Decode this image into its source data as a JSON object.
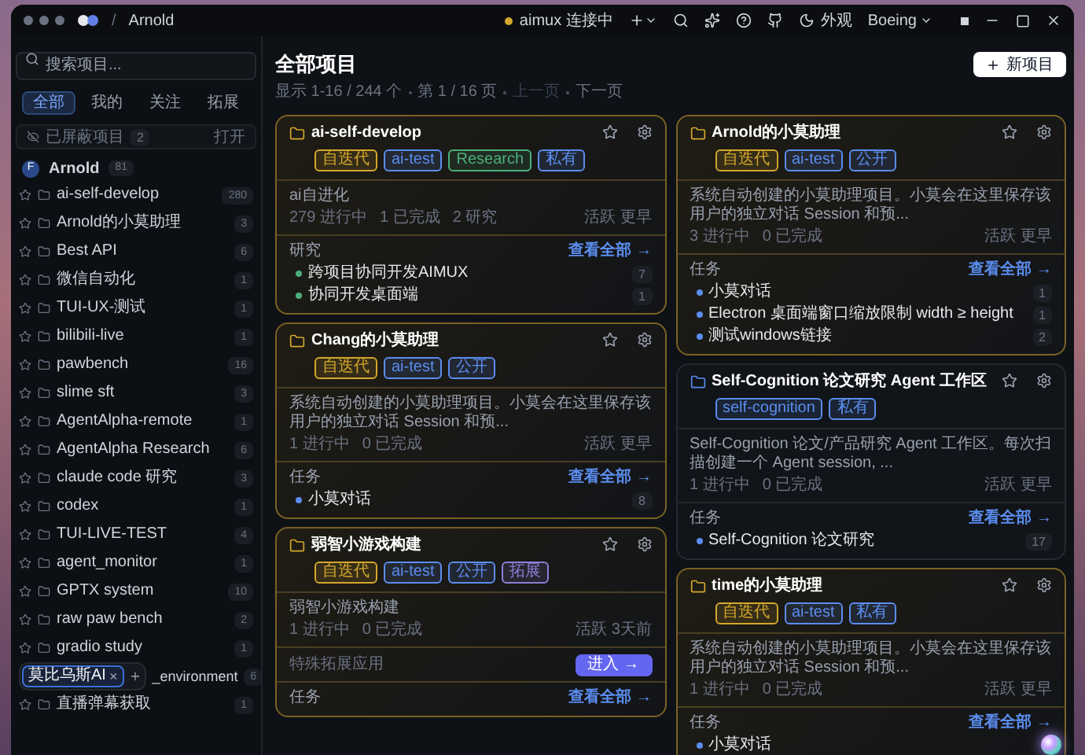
{
  "window": {
    "breadcrumb_separator": "/",
    "title": "Arnold"
  },
  "toolbar": {
    "connection": {
      "label": "aimux 连接中",
      "color": "#d4a72c"
    },
    "appearance": "外观",
    "account": "Boeing"
  },
  "sidebar": {
    "search": {
      "placeholder": "搜索项目..."
    },
    "tabs": [
      {
        "label": "全部",
        "selected": true
      },
      {
        "label": "我的",
        "selected": false
      },
      {
        "label": "关注",
        "selected": false
      },
      {
        "label": "拓展",
        "selected": false
      }
    ],
    "hidden": {
      "label": "已屏蔽项目",
      "count": "2",
      "action": "打开"
    },
    "group": {
      "avatar": "F",
      "name": "Arnold",
      "count": "81"
    },
    "items": [
      {
        "name": "ai-self-develop",
        "count": "280",
        "obscured": false
      },
      {
        "name": "Arnold的小莫助理",
        "count": "3",
        "obscured": false
      },
      {
        "name": "Best API",
        "count": "6",
        "obscured": false
      },
      {
        "name": "微信自动化",
        "count": "1",
        "obscured": false
      },
      {
        "name": "TUI-UX-测试",
        "count": "1",
        "obscured": false
      },
      {
        "name": "bilibili-live",
        "count": "1",
        "obscured": false
      },
      {
        "name": "pawbench",
        "count": "16",
        "obscured": false
      },
      {
        "name": "slime sft",
        "count": "3",
        "obscured": false
      },
      {
        "name": "AgentAlpha-remote",
        "count": "1",
        "obscured": false
      },
      {
        "name": "AgentAlpha Research",
        "count": "6",
        "obscured": false
      },
      {
        "name": "claude code 研究",
        "count": "3",
        "obscured": false
      },
      {
        "name": "codex",
        "count": "1",
        "obscured": false
      },
      {
        "name": "TUI-LIVE-TEST",
        "count": "4",
        "obscured": false
      },
      {
        "name": "agent_monitor",
        "count": "1",
        "obscured": false
      },
      {
        "name": "GPTX system",
        "count": "10",
        "obscured": false
      },
      {
        "name": "raw paw bench",
        "count": "2",
        "obscured": false
      },
      {
        "name": "gradio study",
        "count": "1",
        "obscured": false
      },
      {
        "name": "_environment",
        "count": "6",
        "obscured": true
      },
      {
        "name": "直播弹幕获取",
        "count": "1",
        "obscured": false
      }
    ],
    "floating_tab": {
      "label": "莫比乌斯AI",
      "close": "×"
    }
  },
  "main": {
    "title": "全部项目",
    "new_button": "新项目",
    "pagination": [
      {
        "text": "显示 1-16 / 244 个",
        "disabled": false
      },
      {
        "text": "第 1 / 16 页",
        "disabled": false
      },
      {
        "text": "上一页",
        "disabled": true
      },
      {
        "text": "下一页",
        "disabled": false
      }
    ],
    "project_columns": [
      [
        {
          "name": "ai-self-develop",
          "highlighted": true,
          "tags": [
            {
              "label": "自迭代",
              "color": "#d4a72c"
            },
            {
              "label": "ai-test",
              "color": "#5b8def"
            },
            {
              "label": "Research",
              "color": "#4caf7a"
            },
            {
              "label": "私有",
              "color": "#5b8def"
            }
          ],
          "description": "ai自进化",
          "stats": [
            "279 进行中",
            "1 已完成",
            "2 研究"
          ],
          "activity": "活跃 更早",
          "section": {
            "kind": "research",
            "title": "研究",
            "link": "查看全部 →",
            "items": [
              {
                "name": "跨项目协同开发AIMUX",
                "count": "7"
              },
              {
                "name": "协同开发桌面端",
                "count": "1"
              }
            ]
          }
        },
        {
          "name": "Chang的小莫助理",
          "highlighted": true,
          "tags": [
            {
              "label": "自迭代",
              "color": "#d4a72c"
            },
            {
              "label": "ai-test",
              "color": "#5b8def"
            },
            {
              "label": "公开",
              "color": "#5b8def"
            }
          ],
          "description": "系统自动创建的小莫助理项目。小莫会在这里保存该用户的独立对话 Session 和预...",
          "stats": [
            "1 进行中",
            "0 已完成"
          ],
          "activity": "活跃 更早",
          "section": {
            "kind": "task",
            "title": "任务",
            "link": "查看全部 →",
            "items": [
              {
                "name": "小莫对话",
                "count": "8"
              }
            ]
          }
        },
        {
          "name": "弱智小游戏构建",
          "highlighted": true,
          "tags": [
            {
              "label": "自迭代",
              "color": "#d4a72c"
            },
            {
              "label": "ai-test",
              "color": "#5b8def"
            },
            {
              "label": "公开",
              "color": "#5b8def"
            },
            {
              "label": "拓展",
              "color": "#8b7fd8"
            }
          ],
          "description": "弱智小游戏构建",
          "stats": [
            "1 进行中",
            "0 已完成"
          ],
          "activity": "活跃 3天前",
          "extension": {
            "label": "特殊拓展应用",
            "button": "进入 →"
          },
          "section": {
            "title": "任务",
            "link": "查看全部 →"
          }
        }
      ],
      [
        {
          "name": "Arnold的小莫助理",
          "highlighted": true,
          "tags": [
            {
              "label": "自迭代",
              "color": "#d4a72c"
            },
            {
              "label": "ai-test",
              "color": "#5b8def"
            },
            {
              "label": "公开",
              "color": "#5b8def"
            }
          ],
          "description": "系统自动创建的小莫助理项目。小莫会在这里保存该用户的独立对话 Session 和预...",
          "stats": [
            "3 进行中",
            "0 已完成"
          ],
          "activity": "活跃 更早",
          "section": {
            "kind": "task",
            "title": "任务",
            "link": "查看全部 →",
            "items": [
              {
                "name": "小莫对话",
                "count": "1"
              },
              {
                "name": "Electron 桌面端窗口缩放限制 width ≥ height",
                "count": "1"
              },
              {
                "name": "测试windows链接",
                "count": "2"
              }
            ]
          }
        },
        {
          "name": "Self-Cognition 论文研究 Agent 工作区",
          "highlighted": false,
          "tags": [
            {
              "label": "self-cognition",
              "color": "#5b8def"
            },
            {
              "label": "私有",
              "color": "#5b8def"
            }
          ],
          "description": "Self-Cognition 论文/产品研究 Agent 工作区。每次扫描创建一个 Agent session, ...",
          "stats": [
            "1 进行中",
            "0 已完成"
          ],
          "activity": "活跃 更早",
          "section": {
            "kind": "task",
            "title": "任务",
            "link": "查看全部 →",
            "items": [
              {
                "name": "Self-Cognition 论文研究",
                "count": "17"
              }
            ]
          }
        },
        {
          "name": "time的小莫助理",
          "highlighted": true,
          "tags": [
            {
              "label": "自迭代",
              "color": "#d4a72c"
            },
            {
              "label": "ai-test",
              "color": "#5b8def"
            },
            {
              "label": "私有",
              "color": "#5b8def"
            }
          ],
          "description": "系统自动创建的小莫助理项目。小莫会在这里保存该用户的独立对话 Session 和预...",
          "stats": [
            "1 进行中",
            "0 已完成"
          ],
          "activity": "活跃 更早",
          "section": {
            "kind": "task",
            "title": "任务",
            "link": "查看全部 →",
            "items": [
              {
                "name": "小莫对话"
              }
            ]
          }
        }
      ]
    ]
  }
}
